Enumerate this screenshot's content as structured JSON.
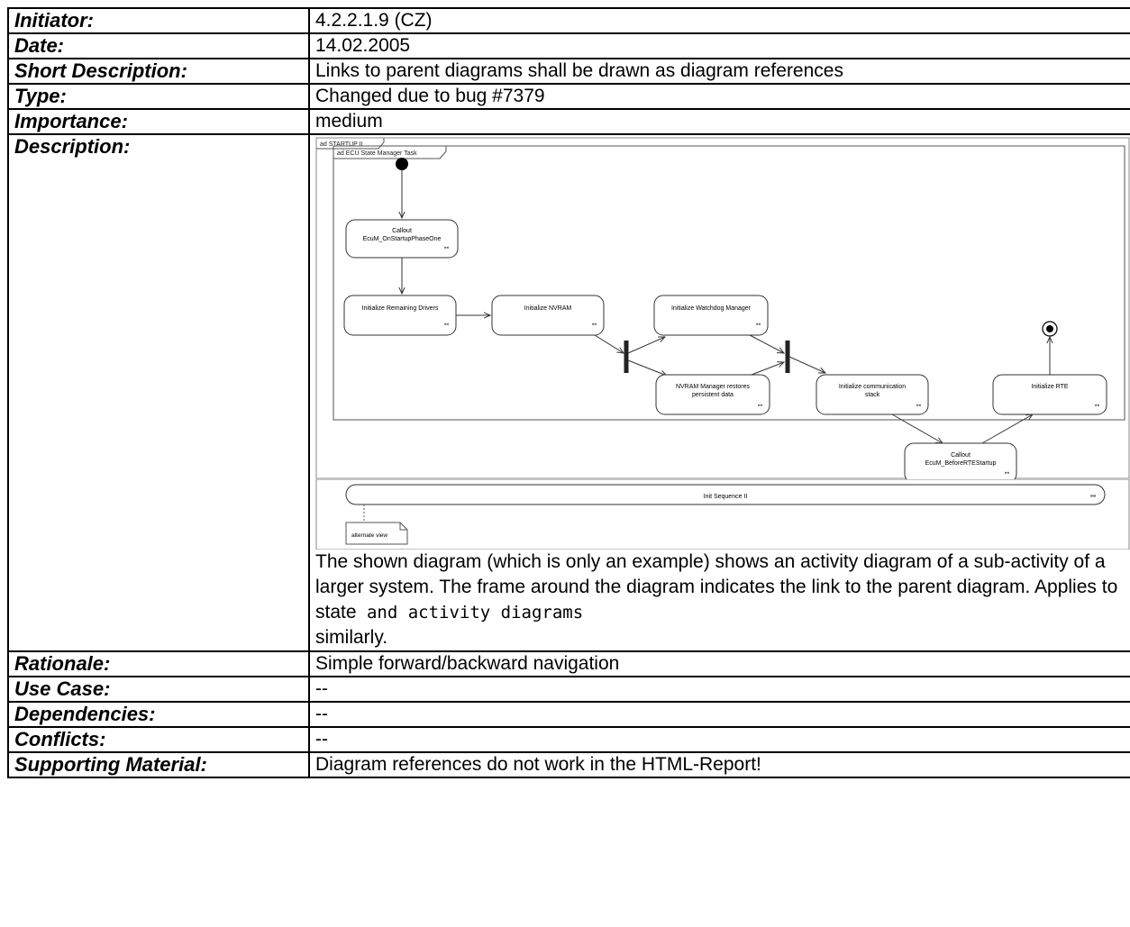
{
  "rows": {
    "initiator": {
      "label": "Initiator:",
      "value": "4.2.2.1.9 (CZ)"
    },
    "date": {
      "label": "Date:",
      "value": "14.02.2005"
    },
    "short_description": {
      "label": "Short Description:",
      "value": "Links to parent diagrams shall be drawn as diagram references"
    },
    "type": {
      "label": "Type:",
      "value": "Changed due to bug #7379"
    },
    "importance": {
      "label": "Importance:",
      "value": "medium"
    },
    "description": {
      "label": "Description:",
      "text_main": "The shown diagram (which is only an example) shows an activity diagram of a sub-activity of a larger system. The frame around the diagram indicates the link to the parent diagram. Applies to state",
      "text_tail": " and activity diagrams",
      "text_end": "similarly."
    },
    "rationale": {
      "label": "Rationale:",
      "value": "Simple forward/backward navigation"
    },
    "use_case": {
      "label": "Use Case:",
      "value": "--"
    },
    "dependencies": {
      "label": "Dependencies:",
      "value": "--"
    },
    "conflicts": {
      "label": "Conflicts:",
      "value": "--"
    },
    "supporting_material": {
      "label": "Supporting Material:",
      "value": "Diagram references do not work in the HTML-Report!"
    }
  },
  "diagram": {
    "outer_frame_label": "ad STARTUP II",
    "inner_frame_label": "ad ECU State Manager Task",
    "callout_one_line1": "Callout",
    "callout_one_line2": "EcuM_OnStartupPhaseOne",
    "init_remaining_drivers": "Initialize Remaining Drivers",
    "init_nvram": "Initialize NVRAM",
    "init_watchdog": "Initialize Watchdog Manager",
    "nvram_restores_line1": "NVRAM Manager restores",
    "nvram_restores_line2": "persistent data",
    "init_comm_line1": "Initialize communication",
    "init_comm_line2": "stack",
    "init_rte": "Initialize RTE",
    "callout_rte_line1": "Callout",
    "callout_rte_line2": "EcuM_BeforeRTEStartup",
    "init_sequence": "Init Sequence II",
    "note": "alternate view"
  }
}
